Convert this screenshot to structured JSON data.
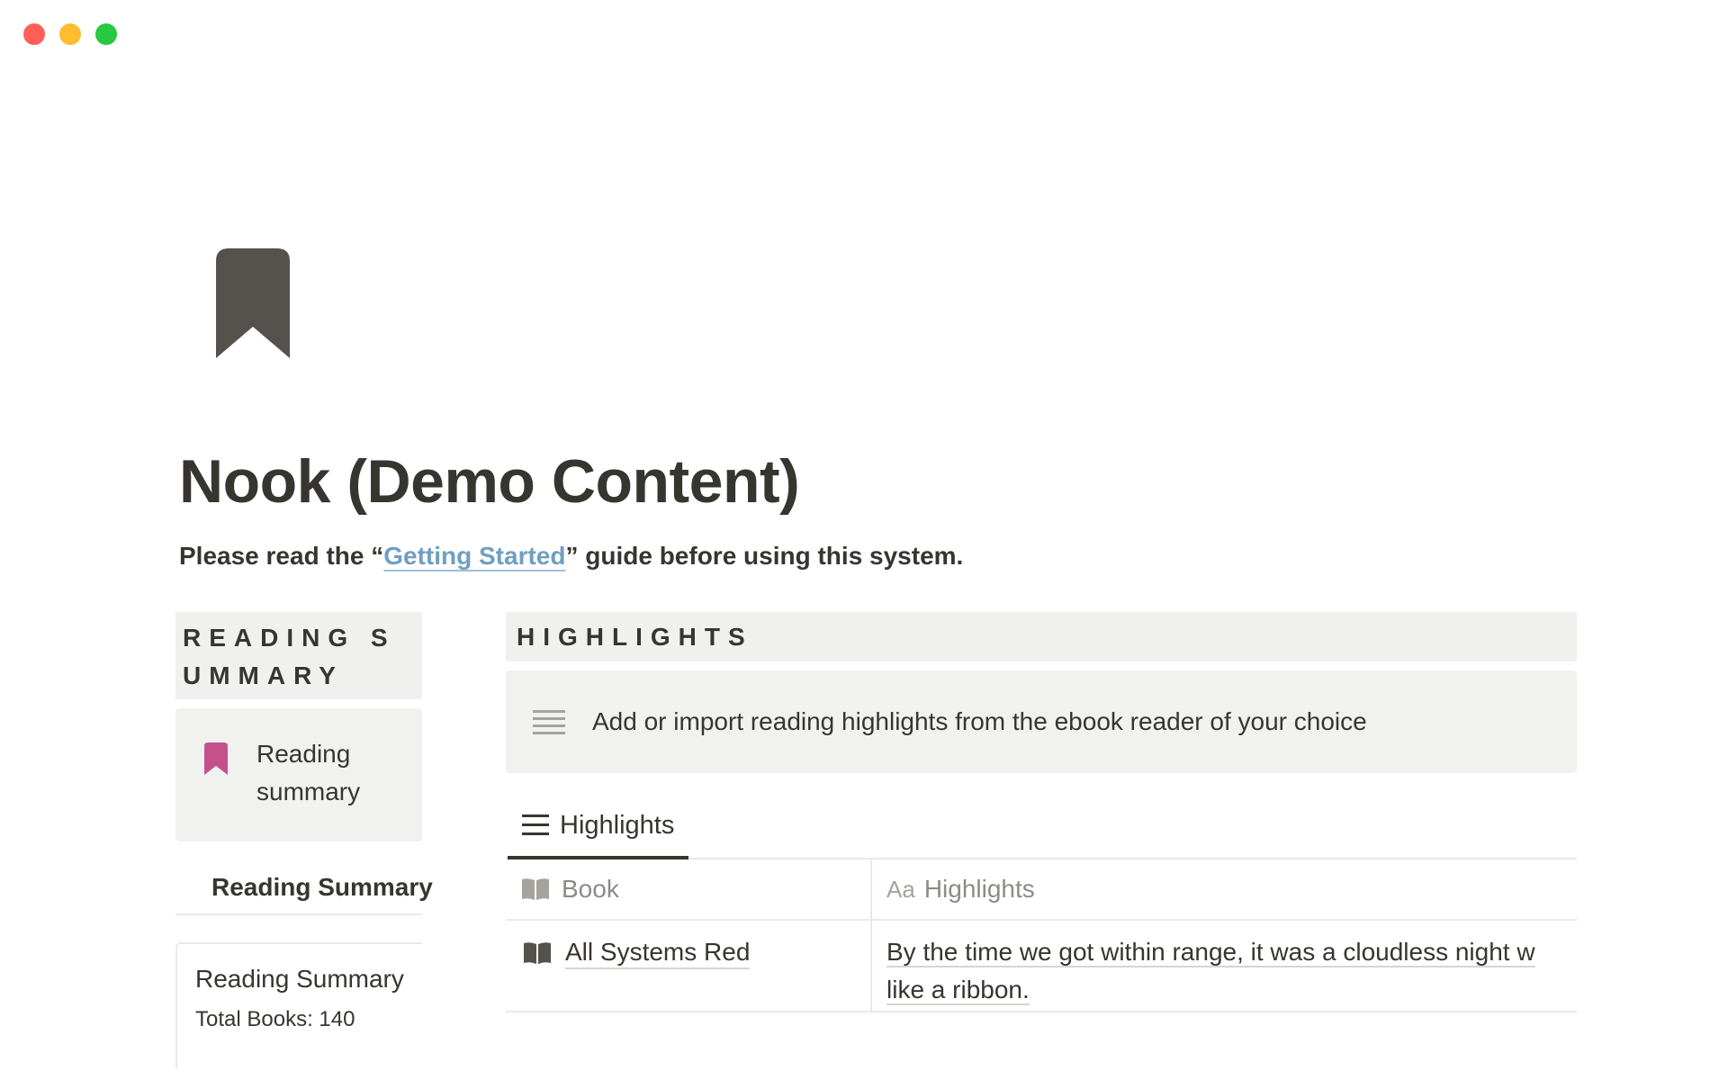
{
  "page": {
    "title": "Nook (Demo Content)",
    "intro_prefix": "Please read the “",
    "intro_link": "Getting Started",
    "intro_suffix": "” guide before using this system."
  },
  "reading_summary": {
    "header": "READING SUMMARY",
    "callout_text": "Reading summary",
    "view_label": "Reading Summary",
    "card_title": "Reading Summary",
    "card_prop": "Total Books: 140"
  },
  "highlights": {
    "header": "HIGHLIGHTS",
    "callout_text": "Add or import reading highlights from the ebook reader of your choice",
    "tab_label": "Highlights",
    "columns": {
      "book": "Book",
      "highlights_prefix": "Aa",
      "highlights": "Highlights"
    },
    "rows": [
      {
        "book": "All Systems Red",
        "highlight_line1": "By the time we got within range, it was a cloudless night w",
        "highlight_line2": "like a ribbon."
      }
    ]
  },
  "colors": {
    "accent_pink": "#c4518a",
    "link_blue": "#6f9fc0",
    "icon_dark": "#55524d"
  },
  "icons": {
    "page_icon": "bookmark-icon",
    "callout_small_icon": "bookmark-icon",
    "callout_big_icon": "lines-icon",
    "book_column_icon": "open-book-icon"
  }
}
